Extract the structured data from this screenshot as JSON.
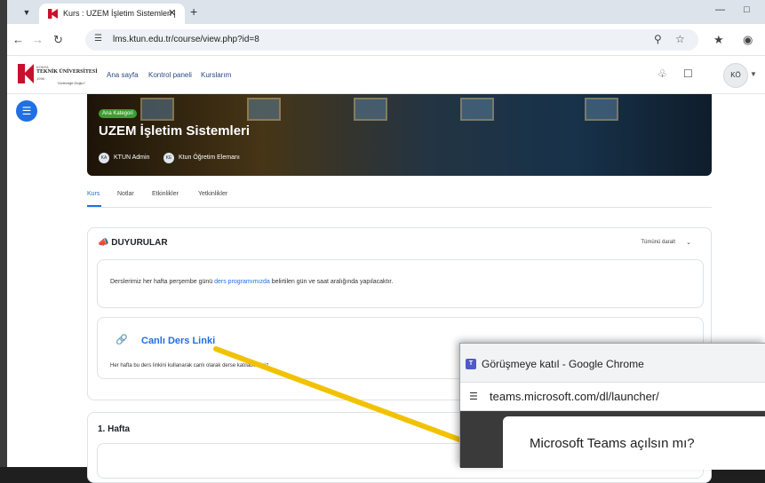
{
  "browser": {
    "tab_title": "Kurs : UZEM İşletim Sistemleri |",
    "url": "lms.ktun.edu.tr/course/view.php?id=8"
  },
  "site": {
    "logo_lines": [
      "KONYA",
      "TEKNİK ÜNİVERSİTESİ",
      "1998",
      "\"Geleceğe Doğru\""
    ],
    "nav": [
      "Ana sayfa",
      "Kontrol paneli",
      "Kurslarım"
    ],
    "user_initials": "KÖ"
  },
  "course": {
    "category_badge": "Ana Kategori",
    "title": "UZEM İşletim Sistemleri",
    "teachers": [
      {
        "initials": "KA",
        "name": "KTUN Admin"
      },
      {
        "initials": "KE",
        "name": "Ktun Öğretim Elemanı"
      }
    ],
    "tabs": [
      "Kurs",
      "Notlar",
      "Etkinlikler",
      "Yetkinlikler"
    ]
  },
  "announcements": {
    "title": "DUYURULAR",
    "collapse_all": "Tümünü daralt",
    "text_before": "Derslerimiz her hafta perşembe günü ",
    "text_link": "ders programımızda",
    "text_after": " belirtilen gün ve saat aralığında yapılacaktır.",
    "live_link_title": "Canlı Ders Linki",
    "live_link_desc": "Her hafta bu ders linkini kullanarak canlı olarak derse katılabilirsiniz."
  },
  "week": {
    "title": "1. Hafta"
  },
  "popup": {
    "title": "Görüşmeye katıl - Google Chrome",
    "url": "teams.microsoft.com/dl/launcher/",
    "dialog_title": "Microsoft Teams açılsın mı?"
  },
  "colors": {
    "accent": "#1f6fe5",
    "annotation_arrow": "#f2c200",
    "brand_red": "#c8102e"
  }
}
